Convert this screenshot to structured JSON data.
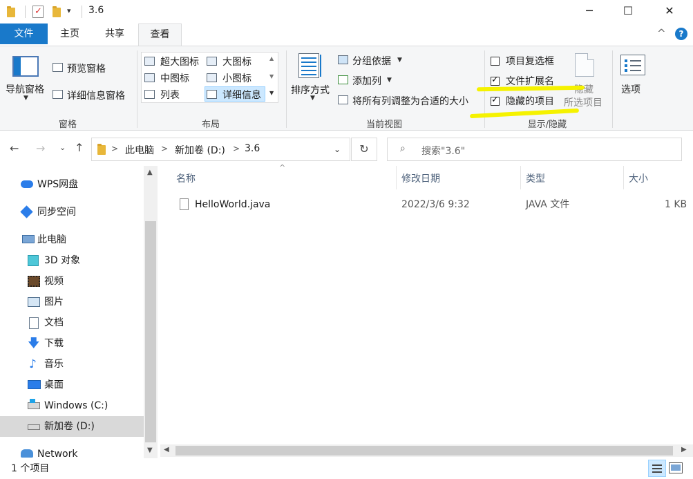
{
  "title": {
    "path_text": "3.6",
    "qa_arrow": "▾",
    "min": "─",
    "max": "☐",
    "close": "✕"
  },
  "tabs": [
    {
      "label": "文件"
    },
    {
      "label": "主页"
    },
    {
      "label": "共享"
    },
    {
      "label": "查看"
    }
  ],
  "ribbon_right": {
    "up": "^",
    "help": "?"
  },
  "ribbon": {
    "panes": {
      "label": "窗格",
      "nav_pane": "导航窗格",
      "preview_pane": "预览窗格",
      "details_pane": "详细信息窗格"
    },
    "layout": {
      "label": "布局",
      "items": [
        "超大图标",
        "大图标",
        "中图标",
        "小图标",
        "列表",
        "详细信息"
      ]
    },
    "current_view": {
      "label": "当前视图",
      "sort_by": "排序方式",
      "group_by": "分组依据",
      "add_column": "添加列",
      "size_all": "将所有列调整为合适的大小"
    },
    "show_hide": {
      "label": "显示/隐藏",
      "item_checkboxes": "项目复选框",
      "item_checkboxes_checked": false,
      "file_extensions": "文件扩展名",
      "file_extensions_checked": true,
      "hidden_items": "隐藏的项目",
      "hidden_items_checked": true,
      "hide_selected_1": "隐藏",
      "hide_selected_2": "所选项目"
    },
    "options": "选项"
  },
  "address": {
    "crumbs": [
      "此电脑",
      "新加卷 (D:)",
      "3.6"
    ],
    "search_placeholder": "搜索\"3.6\""
  },
  "nav": {
    "items": [
      {
        "label": "WPS网盘"
      },
      {
        "label": "同步空间"
      },
      {
        "label": "此电脑"
      },
      {
        "label": "3D 对象"
      },
      {
        "label": "视频"
      },
      {
        "label": "图片"
      },
      {
        "label": "文档"
      },
      {
        "label": "下载"
      },
      {
        "label": "音乐"
      },
      {
        "label": "桌面"
      },
      {
        "label": "Windows (C:)"
      },
      {
        "label": "新加卷 (D:)"
      },
      {
        "label": "Network"
      }
    ]
  },
  "columns": {
    "name": "名称",
    "date": "修改日期",
    "type": "类型",
    "size": "大小"
  },
  "files": [
    {
      "name": "HelloWorld.java",
      "date": "2022/3/6 9:32",
      "type": "JAVA 文件",
      "size": "1 KB"
    }
  ],
  "status": {
    "count": "1 个项目"
  },
  "colors": {
    "accent": "#1979ca",
    "highlight": "#f5f200",
    "selected": "#cce8ff"
  }
}
